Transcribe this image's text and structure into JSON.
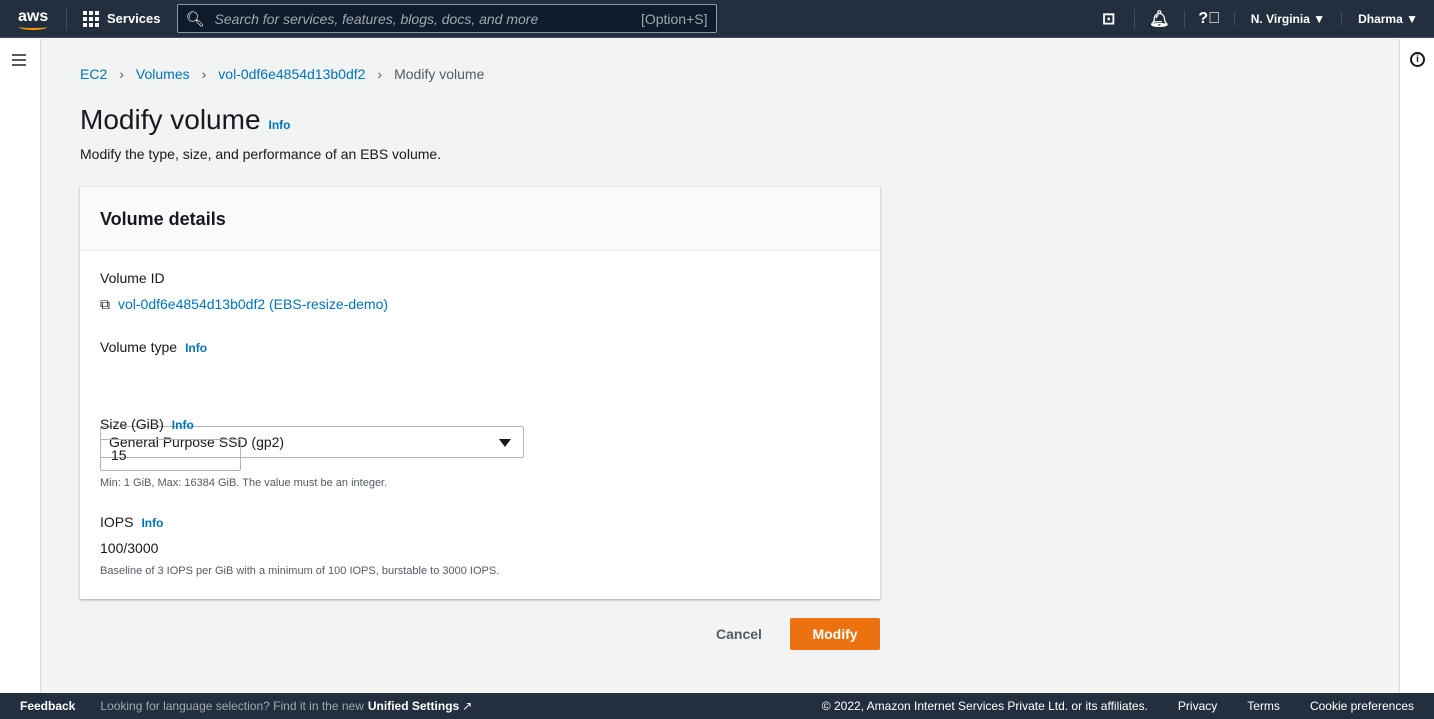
{
  "header": {
    "logo": "aws",
    "services": "Services",
    "search_placeholder": "Search for services, features, blogs, docs, and more",
    "shortcut": "[Option+S]",
    "region": "N. Virginia ▼",
    "user": "Dharma ▼"
  },
  "breadcrumb": [
    "EC2",
    "Volumes",
    "vol-0df6e4854d13b0df2",
    "Modify volume"
  ],
  "page": {
    "title": "Modify volume",
    "info": "Info",
    "description": "Modify the type, size, and performance of an EBS volume."
  },
  "card": {
    "title": "Volume details",
    "volume_id_label": "Volume ID",
    "volume_id": "vol-0df6e4854d13b0df2 (EBS-resize-demo)",
    "type_label": "Volume type",
    "type_value": "General Purpose SSD (gp2)",
    "size_label": "Size (GiB)",
    "size_value": "15",
    "size_hint": "Min: 1 GiB, Max: 16384 GiB. The value must be an integer.",
    "iops_label": "IOPS",
    "iops_value": "100/3000",
    "iops_hint": "Baseline of 3 IOPS per GiB with a minimum of 100 IOPS, burstable to 3000 IOPS.",
    "info": "Info"
  },
  "actions": {
    "cancel": "Cancel",
    "modify": "Modify"
  },
  "footer": {
    "feedback": "Feedback",
    "language": "Looking for language selection? Find it in the new",
    "unified": "Unified Settings",
    "copyright": "© 2022, Amazon Internet Services Private Ltd. or its affiliates.",
    "privacy": "Privacy",
    "terms": "Terms",
    "cookies": "Cookie preferences"
  }
}
